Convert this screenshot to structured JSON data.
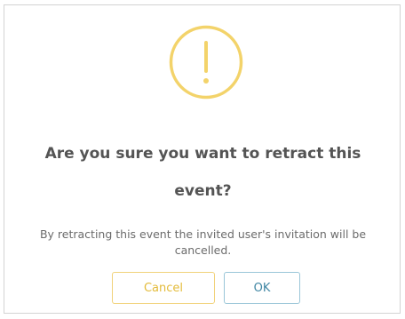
{
  "dialog": {
    "title_line1": "Are you sure you want to retract this",
    "title_line2": "event?",
    "message_line1": "By retracting this event the invited user's invitation will be",
    "message_line2": "cancelled.",
    "icon": "exclamation-circle-icon",
    "cancel_label": "Cancel",
    "ok_label": "OK"
  },
  "colors": {
    "icon": "#f3d36a",
    "cancel_border": "#f1d27a",
    "cancel_text": "#e3bb3a",
    "ok_border": "#9ac6d8",
    "ok_text": "#3f86a3",
    "title_text": "#545454",
    "message_text": "#6b6b6b"
  }
}
